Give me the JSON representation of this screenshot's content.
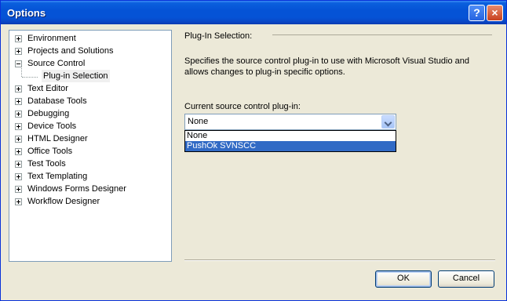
{
  "window": {
    "title": "Options",
    "help_icon": "?",
    "close_icon": "×"
  },
  "tree": {
    "items": [
      {
        "label": "Environment",
        "expander": "plus"
      },
      {
        "label": "Projects and Solutions",
        "expander": "plus"
      },
      {
        "label": "Source Control",
        "expander": "minus"
      },
      {
        "label": "Plug-in Selection",
        "expander": "none",
        "selected": true
      },
      {
        "label": "Text Editor",
        "expander": "plus"
      },
      {
        "label": "Database Tools",
        "expander": "plus"
      },
      {
        "label": "Debugging",
        "expander": "plus"
      },
      {
        "label": "Device Tools",
        "expander": "plus"
      },
      {
        "label": "HTML Designer",
        "expander": "plus"
      },
      {
        "label": "Office Tools",
        "expander": "plus"
      },
      {
        "label": "Test Tools",
        "expander": "plus"
      },
      {
        "label": "Text Templating",
        "expander": "plus"
      },
      {
        "label": "Windows Forms Designer",
        "expander": "plus"
      },
      {
        "label": "Workflow Designer",
        "expander": "plus"
      }
    ]
  },
  "panel": {
    "section_title": "Plug-In Selection:",
    "description": "Specifies the source control plug-in to use with Microsoft Visual Studio and allows changes to plug-in specific options.",
    "combo_label": "Current source control plug-in:",
    "combo_value": "None",
    "options": [
      "None",
      "PushOk SVNSCC"
    ],
    "highlighted_option": "PushOk SVNSCC"
  },
  "buttons": {
    "ok": "OK",
    "cancel": "Cancel"
  },
  "colors": {
    "titlebar": "#0553d6",
    "selection": "#316ac5",
    "dialog_bg": "#ece9d8"
  }
}
